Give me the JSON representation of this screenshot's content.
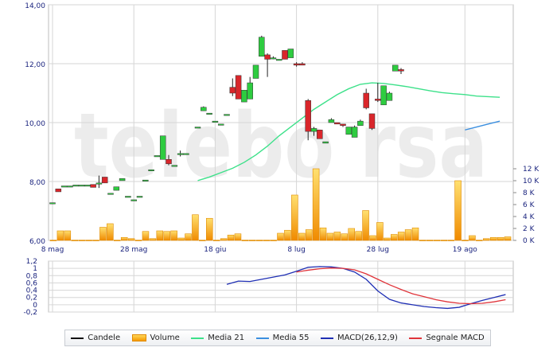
{
  "colors": {
    "up": "#2ecc40",
    "down": "#d9262b",
    "volume": "#f7a51c",
    "media21": "#3de18a",
    "media55": "#3b8fe0",
    "macd": "#1f2fb4",
    "signal": "#e0343a",
    "grid": "#d6d6d6",
    "axis_text": "#1a237e",
    "watermark": "#ececec"
  },
  "watermark": "telebo rsa",
  "legend": [
    {
      "label": "Candele",
      "icon": "line",
      "color": "#111111"
    },
    {
      "label": "Volume",
      "icon": "bar",
      "color": "#f7a51c"
    },
    {
      "label": "Media 21",
      "icon": "line",
      "color": "#3de18a"
    },
    {
      "label": "Media 55",
      "icon": "line",
      "color": "#3b8fe0"
    },
    {
      "label": "MACD(26,12,9)",
      "icon": "line",
      "color": "#1f2fb4"
    },
    {
      "label": "Segnale MACD",
      "icon": "line",
      "color": "#e0343a"
    }
  ],
  "chart_data": [
    {
      "type": "candlestick",
      "x_ticks": [
        {
          "label": "8 mag",
          "i": 0
        },
        {
          "label": "28 mag",
          "i": 14
        },
        {
          "label": "18 giu",
          "i": 28
        },
        {
          "label": "8 lug",
          "i": 42
        },
        {
          "label": "28 lug",
          "i": 56
        },
        {
          "label": "19 ago",
          "i": 71
        }
      ],
      "y_ticks": [
        "6,00",
        "8,00",
        "10,00",
        "12,00",
        "14,00"
      ],
      "ylim": [
        6,
        14
      ],
      "n_slots": 80,
      "ohlc": [
        [
          7.28,
          7.28,
          7.28,
          7.28
        ],
        [
          7.75,
          7.75,
          7.65,
          7.65
        ],
        [
          7.85,
          7.85,
          7.85,
          7.85
        ],
        [
          7.85,
          7.85,
          7.85,
          7.85
        ],
        [
          7.88,
          7.88,
          7.88,
          7.88
        ],
        [
          7.88,
          7.88,
          7.88,
          7.88
        ],
        [
          7.88,
          7.88,
          7.88,
          7.88
        ],
        [
          7.9,
          7.9,
          7.8,
          7.8
        ],
        [
          7.95,
          8.2,
          7.78,
          7.95
        ],
        [
          8.15,
          8.15,
          7.95,
          7.95
        ],
        [
          7.6,
          7.6,
          7.6,
          7.6
        ],
        [
          7.7,
          7.82,
          7.7,
          7.82
        ],
        [
          8.03,
          8.1,
          8.03,
          8.1
        ],
        [
          7.5,
          7.5,
          7.5,
          7.5
        ],
        [
          7.38,
          7.38,
          7.38,
          7.38
        ],
        [
          7.5,
          7.5,
          7.5,
          7.5
        ],
        [
          8.05,
          8.05,
          8.05,
          8.05
        ],
        [
          8.4,
          8.4,
          8.4,
          8.4
        ],
        [
          8.88,
          8.88,
          8.88,
          8.88
        ],
        [
          8.75,
          9.55,
          8.75,
          9.55
        ],
        [
          8.75,
          8.9,
          8.55,
          8.6
        ],
        [
          8.55,
          8.55,
          8.55,
          8.55
        ],
        [
          8.95,
          9.05,
          8.85,
          8.95
        ],
        [
          8.95,
          8.95,
          8.95,
          8.95
        ],
        [
          9.85,
          9.85,
          9.85,
          9.85
        ],
        [
          10.4,
          10.55,
          10.4,
          10.52
        ],
        [
          10.32,
          10.32,
          10.32,
          10.32
        ],
        [
          10.05,
          10.05,
          10.05,
          10.05
        ],
        [
          9.95,
          9.95,
          9.95,
          9.95
        ],
        [
          10.28,
          10.28,
          10.28,
          10.28
        ],
        [
          11.2,
          11.5,
          10.9,
          11.0
        ],
        [
          11.6,
          11.6,
          10.8,
          10.8
        ],
        [
          10.7,
          11.1,
          10.7,
          11.1
        ],
        [
          10.8,
          11.55,
          10.8,
          11.35
        ],
        [
          11.5,
          11.95,
          11.5,
          11.95
        ],
        [
          12.25,
          12.95,
          12.25,
          12.9
        ],
        [
          12.3,
          12.35,
          11.55,
          12.15
        ],
        [
          12.2,
          12.25,
          12.15,
          12.2
        ],
        [
          12.15,
          12.15,
          12.15,
          12.15
        ],
        [
          12.45,
          12.45,
          12.15,
          12.15
        ],
        [
          12.2,
          12.5,
          12.2,
          12.5
        ],
        [
          12.0,
          12.05,
          11.9,
          11.95
        ],
        [
          12.0,
          12.05,
          11.95,
          11.95
        ],
        [
          10.75,
          10.8,
          9.4,
          9.7
        ],
        [
          9.7,
          9.85,
          9.55,
          9.8
        ],
        [
          9.75,
          9.75,
          9.45,
          9.45
        ],
        [
          9.3,
          9.35,
          9.3,
          9.35
        ],
        [
          10.0,
          10.15,
          10.0,
          10.1
        ],
        [
          10.0,
          10.0,
          9.95,
          9.95
        ],
        [
          9.95,
          9.95,
          9.85,
          9.9
        ],
        [
          9.6,
          9.85,
          9.6,
          9.85
        ],
        [
          9.5,
          9.9,
          9.5,
          9.85
        ],
        [
          9.9,
          10.1,
          9.9,
          10.05
        ],
        [
          11.0,
          11.15,
          10.45,
          10.5
        ],
        [
          10.3,
          10.3,
          9.75,
          9.8
        ],
        [
          10.8,
          11.35,
          10.7,
          10.75
        ],
        [
          10.6,
          11.25,
          10.6,
          11.25
        ],
        [
          10.75,
          11.05,
          10.75,
          11.0
        ],
        [
          11.75,
          11.95,
          11.75,
          11.95
        ],
        [
          11.8,
          11.85,
          11.65,
          11.75
        ]
      ],
      "ohlc_slots": [
        0,
        1,
        2,
        3,
        4,
        5,
        6,
        7,
        8,
        9,
        10,
        11,
        12,
        13,
        14,
        15,
        16,
        17,
        18,
        19,
        20,
        21,
        22,
        23,
        25,
        26,
        27,
        28,
        29,
        30,
        31,
        32,
        33,
        34,
        35,
        36,
        37,
        38,
        39,
        40,
        41,
        42,
        43,
        44,
        45,
        46,
        47,
        48,
        49,
        50,
        51,
        52,
        53,
        54,
        55,
        56,
        57,
        58,
        59,
        60
      ],
      "media21": [
        [
          25,
          8.03
        ],
        [
          27,
          8.15
        ],
        [
          29,
          8.3
        ],
        [
          31,
          8.45
        ],
        [
          33,
          8.65
        ],
        [
          35,
          8.9
        ],
        [
          37,
          9.2
        ],
        [
          39,
          9.55
        ],
        [
          41,
          9.85
        ],
        [
          43,
          10.15
        ],
        [
          45,
          10.45
        ],
        [
          47,
          10.7
        ],
        [
          49,
          10.95
        ],
        [
          51,
          11.15
        ],
        [
          53,
          11.3
        ],
        [
          55,
          11.35
        ],
        [
          57,
          11.33
        ],
        [
          59,
          11.28
        ],
        [
          61,
          11.22
        ],
        [
          63,
          11.15
        ],
        [
          65,
          11.08
        ],
        [
          67,
          11.02
        ],
        [
          69,
          10.98
        ],
        [
          71,
          10.95
        ],
        [
          73,
          10.9
        ],
        [
          75,
          10.88
        ],
        [
          77,
          10.86
        ]
      ],
      "media55": [
        [
          71,
          9.75
        ],
        [
          73,
          9.85
        ],
        [
          75,
          9.95
        ],
        [
          77,
          10.05
        ]
      ],
      "volume": {
        "ylim": [
          0,
          12000
        ],
        "y_ticks": [
          "0 K",
          "2 K",
          "4 K",
          "6 K",
          "8 K",
          "10 K",
          "12 K"
        ],
        "values": [
          50,
          1600,
          1600,
          50,
          50,
          50,
          50,
          2200,
          2800,
          50,
          500,
          300,
          50,
          1500,
          300,
          1600,
          1500,
          1600,
          400,
          1100,
          4300,
          50,
          3700,
          50,
          300,
          900,
          1100,
          50,
          50,
          50,
          50,
          50,
          1200,
          1700,
          7600,
          1200,
          1800,
          12000,
          2100,
          1200,
          1400,
          1100,
          2000,
          1500,
          5000,
          800,
          3000,
          400,
          1000,
          1400,
          1800,
          2100,
          50,
          50,
          50,
          50,
          50,
          10000,
          50,
          800,
          50,
          300,
          500,
          500,
          600
        ]
      }
    },
    {
      "type": "line",
      "name": "MACD(26,12,9)",
      "ylim": [
        -0.2,
        1.2
      ],
      "y_ticks": [
        "-0,2",
        "0",
        "0,2",
        "0,4",
        "0,6",
        "0,8",
        "1",
        "1,2"
      ],
      "series": [
        {
          "name": "MACD(26,12,9)",
          "x": [
            30,
            32,
            34,
            36,
            38,
            40,
            42,
            44,
            46,
            48,
            50,
            52,
            54,
            56,
            58,
            60,
            62,
            64,
            66,
            68,
            70,
            72,
            74,
            76,
            78
          ],
          "y": [
            0.56,
            0.65,
            0.64,
            0.7,
            0.76,
            0.82,
            0.92,
            1.03,
            1.05,
            1.04,
            1.0,
            0.9,
            0.7,
            0.38,
            0.15,
            0.05,
            0.0,
            -0.05,
            -0.08,
            -0.1,
            -0.07,
            0.03,
            0.12,
            0.2,
            0.28
          ]
        },
        {
          "name": "Segnale MACD",
          "x": [
            42,
            44,
            46,
            48,
            50,
            52,
            54,
            56,
            58,
            60,
            62,
            64,
            66,
            68,
            70,
            72,
            74,
            76,
            78
          ],
          "y": [
            0.9,
            0.95,
            0.99,
            1.01,
            1.0,
            0.96,
            0.85,
            0.7,
            0.55,
            0.42,
            0.3,
            0.22,
            0.14,
            0.08,
            0.04,
            0.03,
            0.04,
            0.08,
            0.14
          ]
        }
      ]
    }
  ]
}
